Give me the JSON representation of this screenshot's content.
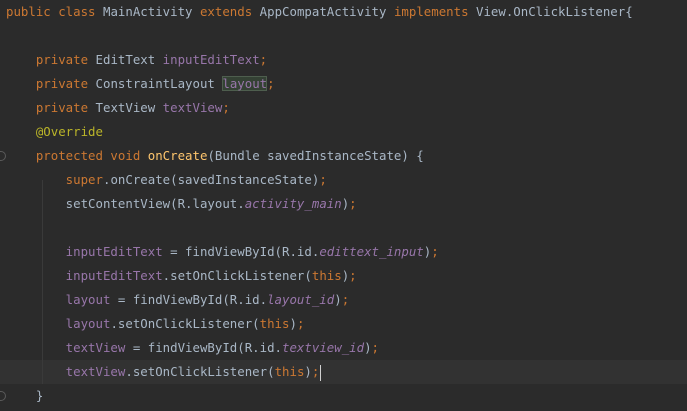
{
  "editor": {
    "lines": [
      {
        "tokens": [
          {
            "text": "public class ",
            "cls": "kw"
          },
          {
            "text": "MainActivity ",
            "cls": "plain"
          },
          {
            "text": "extends ",
            "cls": "kw"
          },
          {
            "text": "AppCompatActivity ",
            "cls": "plain"
          },
          {
            "text": "implements ",
            "cls": "kw"
          },
          {
            "text": "View.OnClickListener{",
            "cls": "plain"
          }
        ]
      },
      {
        "tokens": []
      },
      {
        "tokens": [
          {
            "text": "    private ",
            "cls": "kw"
          },
          {
            "text": "EditText ",
            "cls": "plain"
          },
          {
            "text": "inputEditText",
            "cls": "field"
          },
          {
            "text": ";",
            "cls": "kw"
          }
        ]
      },
      {
        "tokens": [
          {
            "text": "    private ",
            "cls": "kw"
          },
          {
            "text": "ConstraintLayout ",
            "cls": "plain"
          },
          {
            "text": "layout",
            "cls": "field hl"
          },
          {
            "text": ";",
            "cls": "kw"
          }
        ]
      },
      {
        "tokens": [
          {
            "text": "    private ",
            "cls": "kw"
          },
          {
            "text": "TextView ",
            "cls": "plain"
          },
          {
            "text": "textView",
            "cls": "field"
          },
          {
            "text": ";",
            "cls": "kw"
          }
        ]
      },
      {
        "tokens": [
          {
            "text": "    @Override",
            "cls": "ann"
          }
        ]
      },
      {
        "tokens": [
          {
            "text": "    protected void ",
            "cls": "kw"
          },
          {
            "text": "onCreate",
            "cls": "fn"
          },
          {
            "text": "(Bundle savedInstanceState) {",
            "cls": "plain"
          }
        ]
      },
      {
        "tokens": [
          {
            "text": "        super",
            "cls": "kw"
          },
          {
            "text": ".onCreate(savedInstanceState)",
            "cls": "plain"
          },
          {
            "text": ";",
            "cls": "kw"
          }
        ]
      },
      {
        "tokens": [
          {
            "text": "        setContentView(R.layout.",
            "cls": "plain"
          },
          {
            "text": "activity_main",
            "cls": "ital"
          },
          {
            "text": ")",
            "cls": "plain"
          },
          {
            "text": ";",
            "cls": "kw"
          }
        ]
      },
      {
        "tokens": []
      },
      {
        "tokens": [
          {
            "text": "        inputEditText",
            "cls": "field"
          },
          {
            "text": " = findViewById(R.id.",
            "cls": "plain"
          },
          {
            "text": "edittext_input",
            "cls": "ital"
          },
          {
            "text": ")",
            "cls": "plain"
          },
          {
            "text": ";",
            "cls": "kw"
          }
        ]
      },
      {
        "tokens": [
          {
            "text": "        inputEditText",
            "cls": "field"
          },
          {
            "text": ".setOnClickListener(",
            "cls": "plain"
          },
          {
            "text": "this",
            "cls": "kw"
          },
          {
            "text": ")",
            "cls": "plain"
          },
          {
            "text": ";",
            "cls": "kw"
          }
        ]
      },
      {
        "tokens": [
          {
            "text": "        layout",
            "cls": "field"
          },
          {
            "text": " = findViewById(R.id.",
            "cls": "plain"
          },
          {
            "text": "layout_id",
            "cls": "ital"
          },
          {
            "text": ")",
            "cls": "plain"
          },
          {
            "text": ";",
            "cls": "kw"
          }
        ]
      },
      {
        "tokens": [
          {
            "text": "        layout",
            "cls": "field"
          },
          {
            "text": ".setOnClickListener(",
            "cls": "plain"
          },
          {
            "text": "this",
            "cls": "kw"
          },
          {
            "text": ")",
            "cls": "plain"
          },
          {
            "text": ";",
            "cls": "kw"
          }
        ]
      },
      {
        "tokens": [
          {
            "text": "        textView",
            "cls": "field"
          },
          {
            "text": " = findViewById(R.id.",
            "cls": "plain"
          },
          {
            "text": "textview_id",
            "cls": "ital"
          },
          {
            "text": ")",
            "cls": "plain"
          },
          {
            "text": ";",
            "cls": "kw"
          }
        ]
      },
      {
        "tokens": [
          {
            "text": "        textView",
            "cls": "field"
          },
          {
            "text": ".setOnClickListener(",
            "cls": "plain"
          },
          {
            "text": "this",
            "cls": "kw"
          },
          {
            "text": ")",
            "cls": "plain"
          },
          {
            "text": ";",
            "cls": "kw"
          }
        ],
        "current": true,
        "caret": true
      },
      {
        "tokens": [
          {
            "text": "    }",
            "cls": "plain"
          }
        ]
      }
    ]
  },
  "colors": {
    "background": "#2b2b2b",
    "keyword": "#cc7832",
    "field": "#9876aa",
    "method": "#ffc66d",
    "annotation": "#bbb529",
    "text": "#a9b7c6",
    "current_line": "#323232"
  }
}
